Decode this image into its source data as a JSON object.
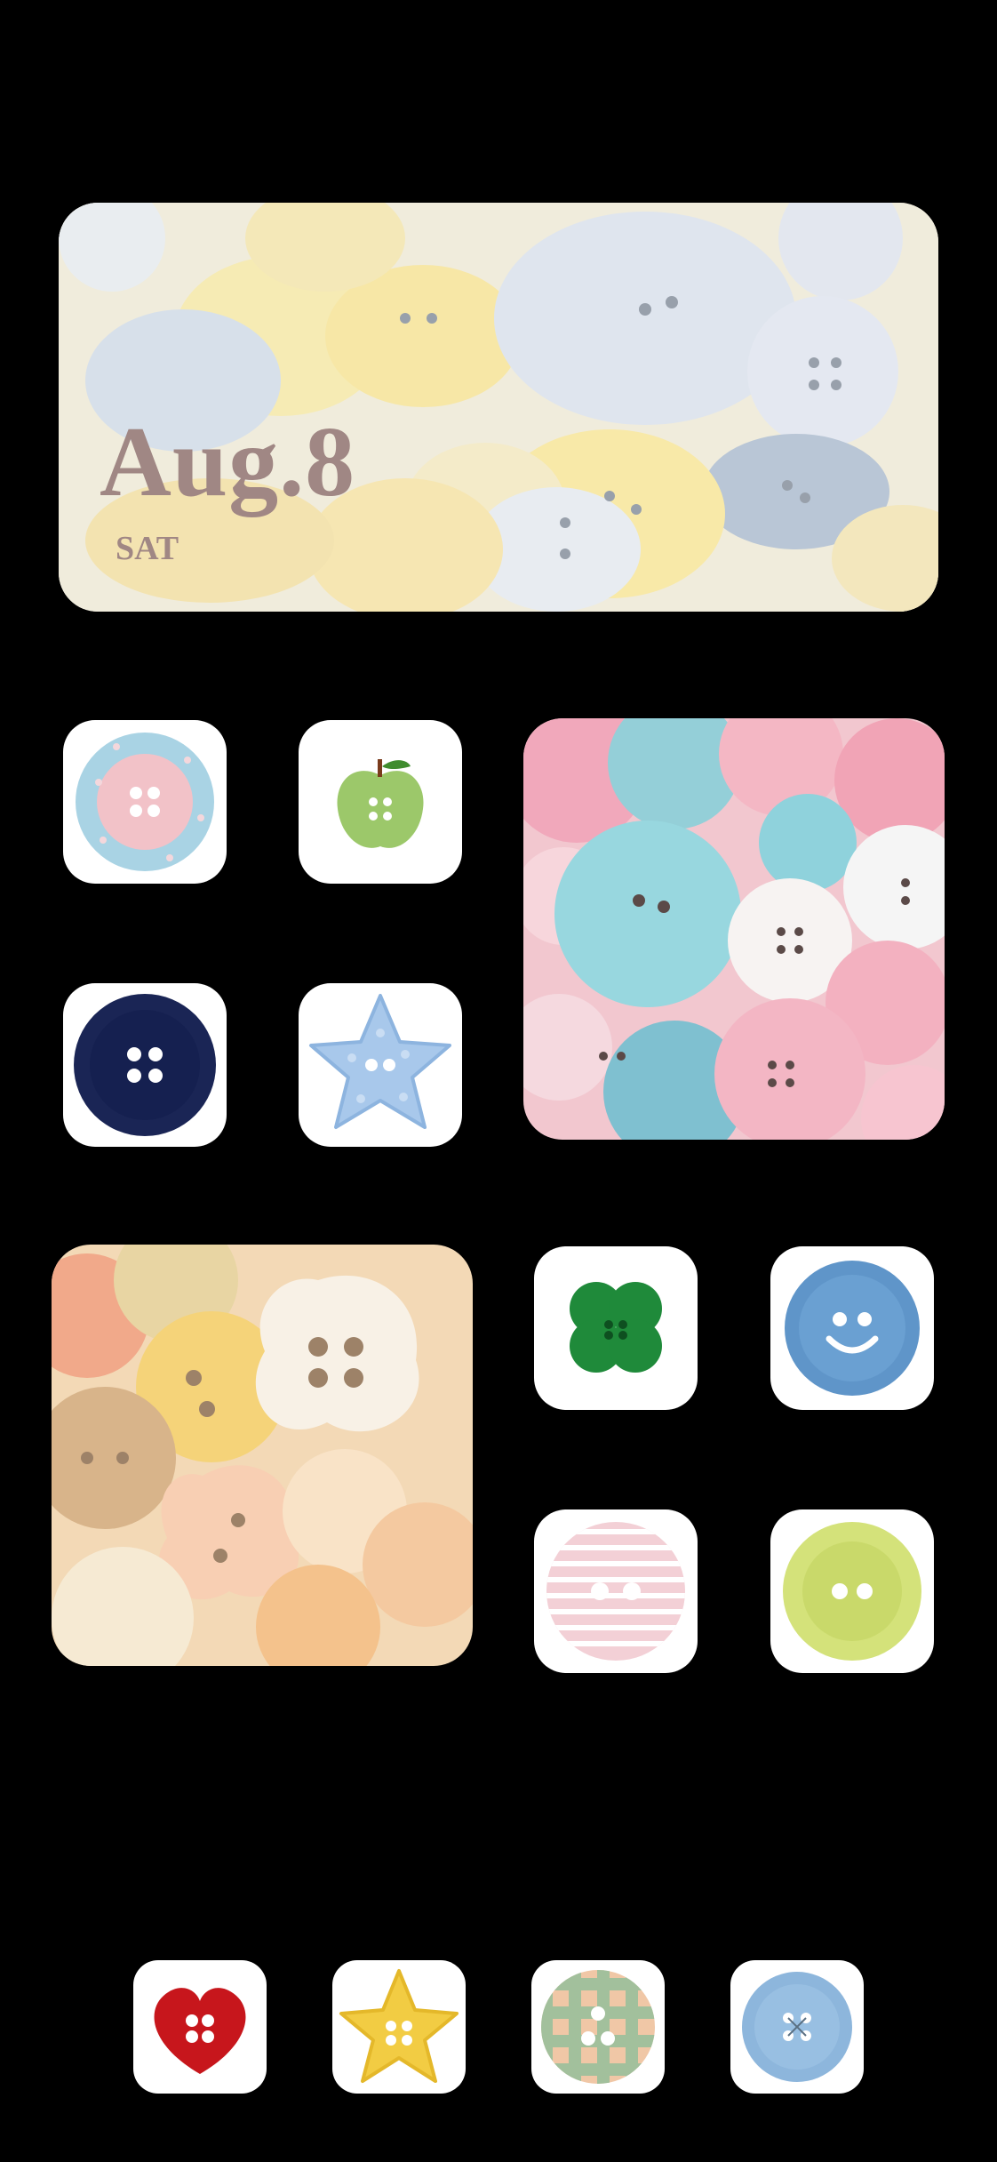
{
  "date_widget": {
    "date": "Aug.8",
    "weekday": "SAT"
  },
  "apps": [
    {
      "icon": "pink-polka-button-icon"
    },
    {
      "icon": "green-apple-button-icon"
    },
    {
      "icon": "navy-button-icon"
    },
    {
      "icon": "blue-star-button-icon"
    },
    {
      "icon": "green-clover-button-icon"
    },
    {
      "icon": "blue-smiley-button-icon"
    },
    {
      "icon": "pink-striped-button-icon"
    },
    {
      "icon": "lime-button-icon"
    }
  ],
  "dock": [
    {
      "icon": "red-heart-button-icon"
    },
    {
      "icon": "yellow-star-button-icon"
    },
    {
      "icon": "gingham-button-icon"
    },
    {
      "icon": "light-blue-button-icon"
    }
  ],
  "colors": {
    "background": "#000000",
    "date_text": "#a08784"
  }
}
